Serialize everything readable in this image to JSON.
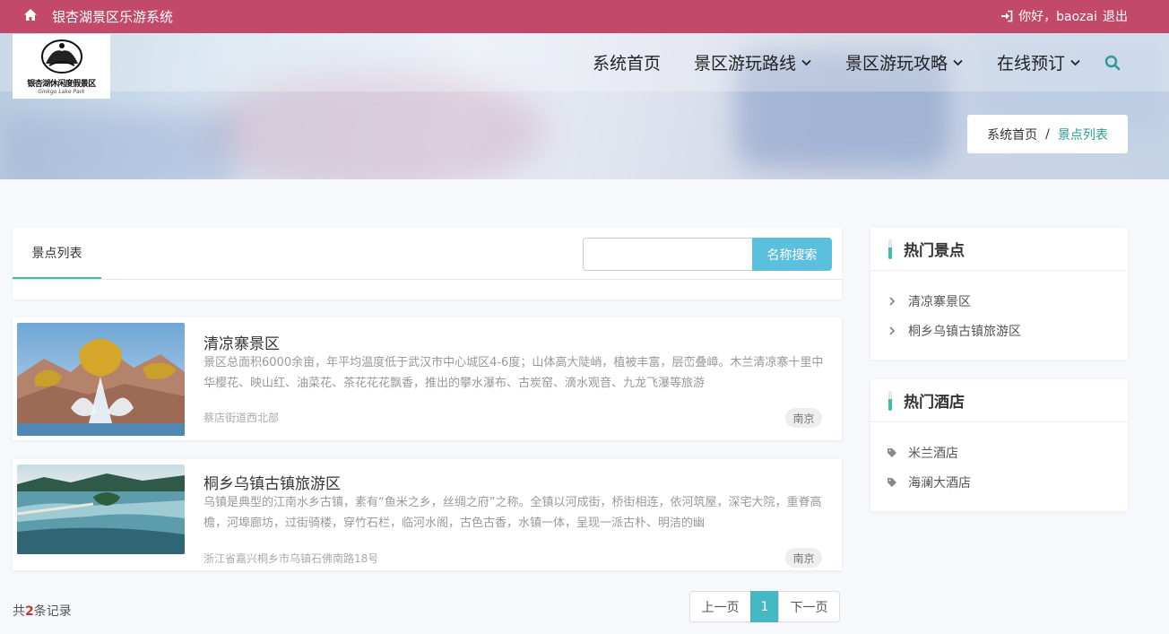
{
  "topbar": {
    "title": "银杏湖景区乐游系统",
    "greeting": "你好，baozai",
    "logout": "退出"
  },
  "logo": {
    "name": "银杏湖休闲度假景区",
    "sub": "Ginkgo Lake Park"
  },
  "nav": {
    "items": [
      "系统首页",
      "景区游玩路线",
      "景区游玩攻略",
      "在线预订"
    ]
  },
  "breadcrumb": {
    "home": "系统首页",
    "separator": "/",
    "current": "景点列表"
  },
  "list": {
    "tab_label": "景点列表",
    "search_placeholder": "",
    "search_button": "名称搜索",
    "items": [
      {
        "title": "清凉寨景区",
        "desc": "景区总面积6000余亩，年平均温度低于武汉市中心城区4-6度；山体高大陡峭，植被丰富，层峦叠嶂。木兰清凉寨十里中华樱花、映山红、油菜花、茶花花花飘香，推出的攀水瀑布、古炭窑、滴水观音、九龙飞瀑等旅游",
        "address": "蔡店街道西北部",
        "tag": "南京"
      },
      {
        "title": "桐乡乌镇古镇旅游区",
        "desc": "乌镇是典型的江南水乡古镇，素有“鱼米之乡，丝绸之府”之称。全镇以河成街，桥街相连，依河筑屋，深宅大院，重脊高檐，河埠廊坊，过街骑楼，穿竹石栏，临河水阁，古色古香，水镇一体，呈现一派古朴、明洁的幽",
        "address": "浙江省嘉兴桐乡市乌镇石佛南路18号",
        "tag": "南京"
      }
    ],
    "count_prefix": "共",
    "count": "2",
    "count_suffix": "条记录"
  },
  "pagination": {
    "prev": "上一页",
    "current": "1",
    "next": "下一页"
  },
  "sidebar": {
    "hot_spots": {
      "title": "热门景点",
      "items": [
        "清凉寨景区",
        "桐乡乌镇古镇旅游区"
      ]
    },
    "hot_hotels": {
      "title": "热门酒店",
      "items": [
        "米兰酒店",
        "海澜大酒店"
      ]
    }
  },
  "colors": {
    "topbar": "#c2496a",
    "accent": "#3cbfa6",
    "search_button": "#5bc0de",
    "pager_active": "#46b8c3"
  },
  "icons": [
    "home-icon",
    "sign-in-icon",
    "chevron-down-icon",
    "search-icon",
    "chevron-right-icon",
    "tag-icon"
  ]
}
